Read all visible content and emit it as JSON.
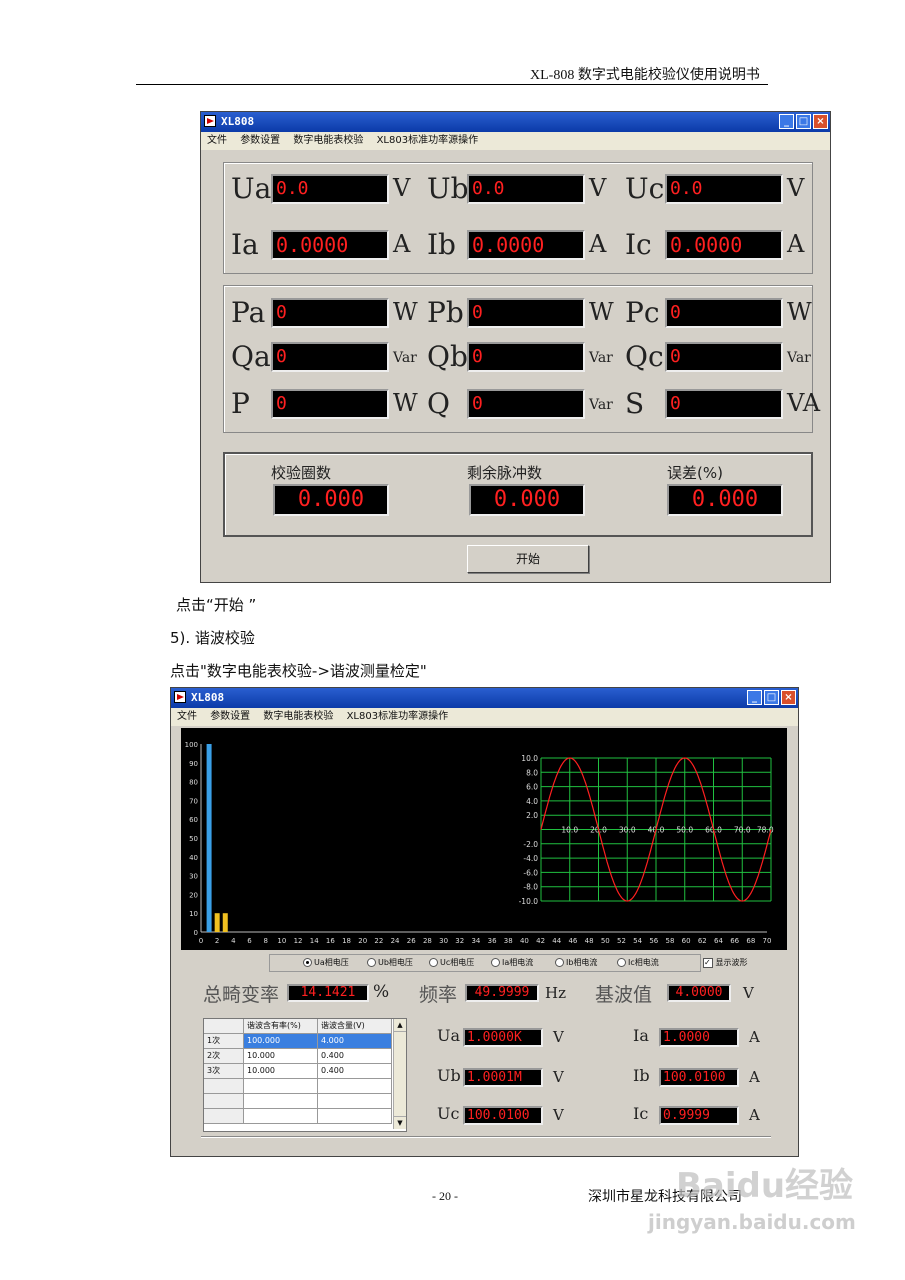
{
  "page_header": "XL-808 数字式电能校验仪使用说明书",
  "window1": {
    "title": "XL808",
    "menu": [
      "文件",
      "参数设置",
      "数字电能表校验",
      "XL803标准功率源操作"
    ],
    "voltage_row": [
      {
        "label": "Ua",
        "value": "0.0",
        "unit": "V"
      },
      {
        "label": "Ub",
        "value": "0.0",
        "unit": "V"
      },
      {
        "label": "Uc",
        "value": "0.0",
        "unit": "V"
      }
    ],
    "current_row": [
      {
        "label": "Ia",
        "value": "0.0000",
        "unit": "A"
      },
      {
        "label": "Ib",
        "value": "0.0000",
        "unit": "A"
      },
      {
        "label": "Ic",
        "value": "0.0000",
        "unit": "A"
      }
    ],
    "power_rows": [
      [
        {
          "label": "Pa",
          "value": "0",
          "unit": "W"
        },
        {
          "label": "Pb",
          "value": "0",
          "unit": "W"
        },
        {
          "label": "Pc",
          "value": "0",
          "unit": "W"
        }
      ],
      [
        {
          "label": "Qa",
          "value": "0",
          "unit": "Var"
        },
        {
          "label": "Qb",
          "value": "0",
          "unit": "Var"
        },
        {
          "label": "Qc",
          "value": "0",
          "unit": "Var"
        }
      ],
      [
        {
          "label": "P",
          "value": "0",
          "unit": "W"
        },
        {
          "label": "Q",
          "value": "0",
          "unit": "Var"
        },
        {
          "label": "S",
          "value": "0",
          "unit": "VA"
        }
      ]
    ],
    "check": [
      {
        "label": "校验圈数",
        "value": "0.000"
      },
      {
        "label": "剩余脉冲数",
        "value": "0.000"
      },
      {
        "label": "误差(%)",
        "value": "0.000"
      }
    ],
    "start_button": "开始"
  },
  "text": {
    "line1": "点击“开始 ”",
    "line2": "5). 谐波校验",
    "line3": "点击\"数字电能表校验->谐波测量检定\""
  },
  "window2": {
    "title": "XL808",
    "menu": [
      "文件",
      "参数设置",
      "数字电能表校验",
      "XL803标准功率源操作"
    ],
    "radios": [
      "Ua相电压",
      "Ub相电压",
      "Uc相电压",
      "Ia相电流",
      "Ib相电流",
      "Ic相电流"
    ],
    "show_wave": "显示波形",
    "thd_label": "总畸变率",
    "thd_value": "14.1421",
    "thd_unit": "%",
    "freq_label": "频率",
    "freq_value": "49.9999",
    "freq_unit": "Hz",
    "fund_label": "基波值",
    "fund_value": "4.0000",
    "fund_unit": "V",
    "table": {
      "headers": [
        "",
        "谐波含有率(%)",
        "谐波含量(V)"
      ],
      "rows": [
        [
          "1次",
          "100.000",
          "4.000"
        ],
        [
          "2次",
          "10.000",
          "0.400"
        ],
        [
          "3次",
          "10.000",
          "0.400"
        ]
      ]
    },
    "meters": [
      {
        "label": "Ua",
        "value": "1.0000K",
        "unit": "V"
      },
      {
        "label": "Ub",
        "value": "1.0001M",
        "unit": "V"
      },
      {
        "label": "Uc",
        "value": "100.0100",
        "unit": "V"
      },
      {
        "label": "Ia",
        "value": "1.0000",
        "unit": "A"
      },
      {
        "label": "Ib",
        "value": "100.0100",
        "unit": "A"
      },
      {
        "label": "Ic",
        "value": "0.9999",
        "unit": "A"
      }
    ]
  },
  "chart_data": [
    {
      "type": "bar",
      "x_ticks": [
        0,
        2,
        4,
        6,
        8,
        10,
        12,
        14,
        16,
        18,
        20,
        22,
        24,
        26,
        28,
        30,
        32,
        34,
        36,
        38,
        40,
        42,
        44,
        46,
        48,
        50,
        52,
        54,
        56,
        58,
        60,
        62,
        64,
        66,
        68,
        70
      ],
      "y_ticks": [
        0,
        10,
        20,
        30,
        40,
        50,
        60,
        70,
        80,
        90,
        100
      ],
      "xlim": [
        0,
        70
      ],
      "ylim": [
        0,
        100
      ],
      "bars": [
        {
          "x": 1,
          "value": 100
        },
        {
          "x": 2,
          "value": 10
        },
        {
          "x": 3,
          "value": 10
        }
      ],
      "colors": {
        "fundamental": "#3aa0e8",
        "harmonic": "#f0c020"
      },
      "grid": false
    },
    {
      "type": "line",
      "x_ticks": [
        "10.0",
        "20.0",
        "30.0",
        "40.0",
        "50.0",
        "60.0",
        "70.0",
        "78.0"
      ],
      "y_ticks": [
        "10.0",
        "8.0",
        "6.0",
        "4.0",
        "2.0",
        "-2.0",
        "-4.0",
        "-6.0",
        "-8.0",
        "-10.0"
      ],
      "xlim": [
        0,
        80
      ],
      "ylim": [
        -10,
        10
      ],
      "series": [
        {
          "amplitude": 10,
          "period": 40,
          "color": "#ff2020"
        }
      ],
      "grid": true,
      "grid_color": "#20c040"
    }
  ],
  "footer": {
    "page_number": "- 20 -",
    "company": "深圳市星龙科技有限公司"
  },
  "watermark": {
    "brand": "Baidu经验",
    "url": "jingyan.baidu.com"
  }
}
